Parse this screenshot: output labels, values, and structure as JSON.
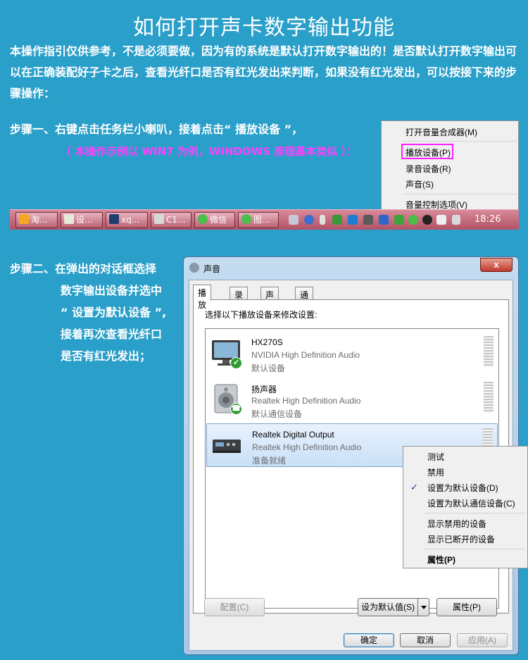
{
  "title": "如何打开声卡数字输出功能",
  "intro": "本操作指引仅供参考，不是必须要做，因为有的系统是默认打开数字输出的！是否默认打开数字输出可以在正确装配好子卡之后，查看光纤口是否有红光发出来判断，如果没有红光发出，可以按接下来的步骤操作：",
  "step1": {
    "text": "步骤一、右键点击任务栏小喇叭，接着点击“ 播放设备 ”，",
    "note": "（ 本操作示例以 WIN7 为例，WINDOWS 原理基本类似 ）："
  },
  "tray_menu": {
    "items": [
      "打开音量合成器(M)",
      "播放设备(P)",
      "录音设备(R)",
      "声音(S)",
      "音量控制选项(V)"
    ]
  },
  "taskbar": {
    "buttons": [
      "淘...",
      "设...",
      "xq...",
      "C1...",
      "微信",
      "图..."
    ],
    "clock": "18:26"
  },
  "step2": {
    "lines": [
      "步骤二、在弹出的对话框选择",
      "数字输出设备并选中",
      "“ 设置为默认设备 ”,",
      "接着再次查看光纤口",
      "是否有红光发出；"
    ]
  },
  "dialog": {
    "title": "声音",
    "close": "x",
    "tabs": [
      "播放",
      "录制",
      "声音",
      "通信"
    ],
    "panel_label": "选择以下播放设备来修改设置:",
    "devices": [
      {
        "name": "HX270S",
        "driver": "NVIDIA High Definition Audio",
        "status": "默认设备"
      },
      {
        "name": "扬声器",
        "driver": "Realtek High Definition Audio",
        "status": "默认通信设备"
      },
      {
        "name": "Realtek Digital Output",
        "driver": "Realtek High Definition Audio",
        "status": "准备就绪"
      }
    ],
    "buttons": {
      "configure": "配置(C)",
      "set_default": "设为默认值(S)",
      "properties": "属性(P)",
      "ok": "确定",
      "cancel": "取消",
      "apply": "应用(A)"
    }
  },
  "device_menu": {
    "items": [
      "测试",
      "禁用",
      "设置为默认设备(D)",
      "设置为默认通信设备(C)",
      "显示禁用的设备",
      "显示已断开的设备",
      "属性(P)"
    ],
    "check": "✓"
  },
  "colors": {
    "background": "#2a9fc9",
    "highlight": "#ff20ff",
    "note": "#ff40ff"
  }
}
